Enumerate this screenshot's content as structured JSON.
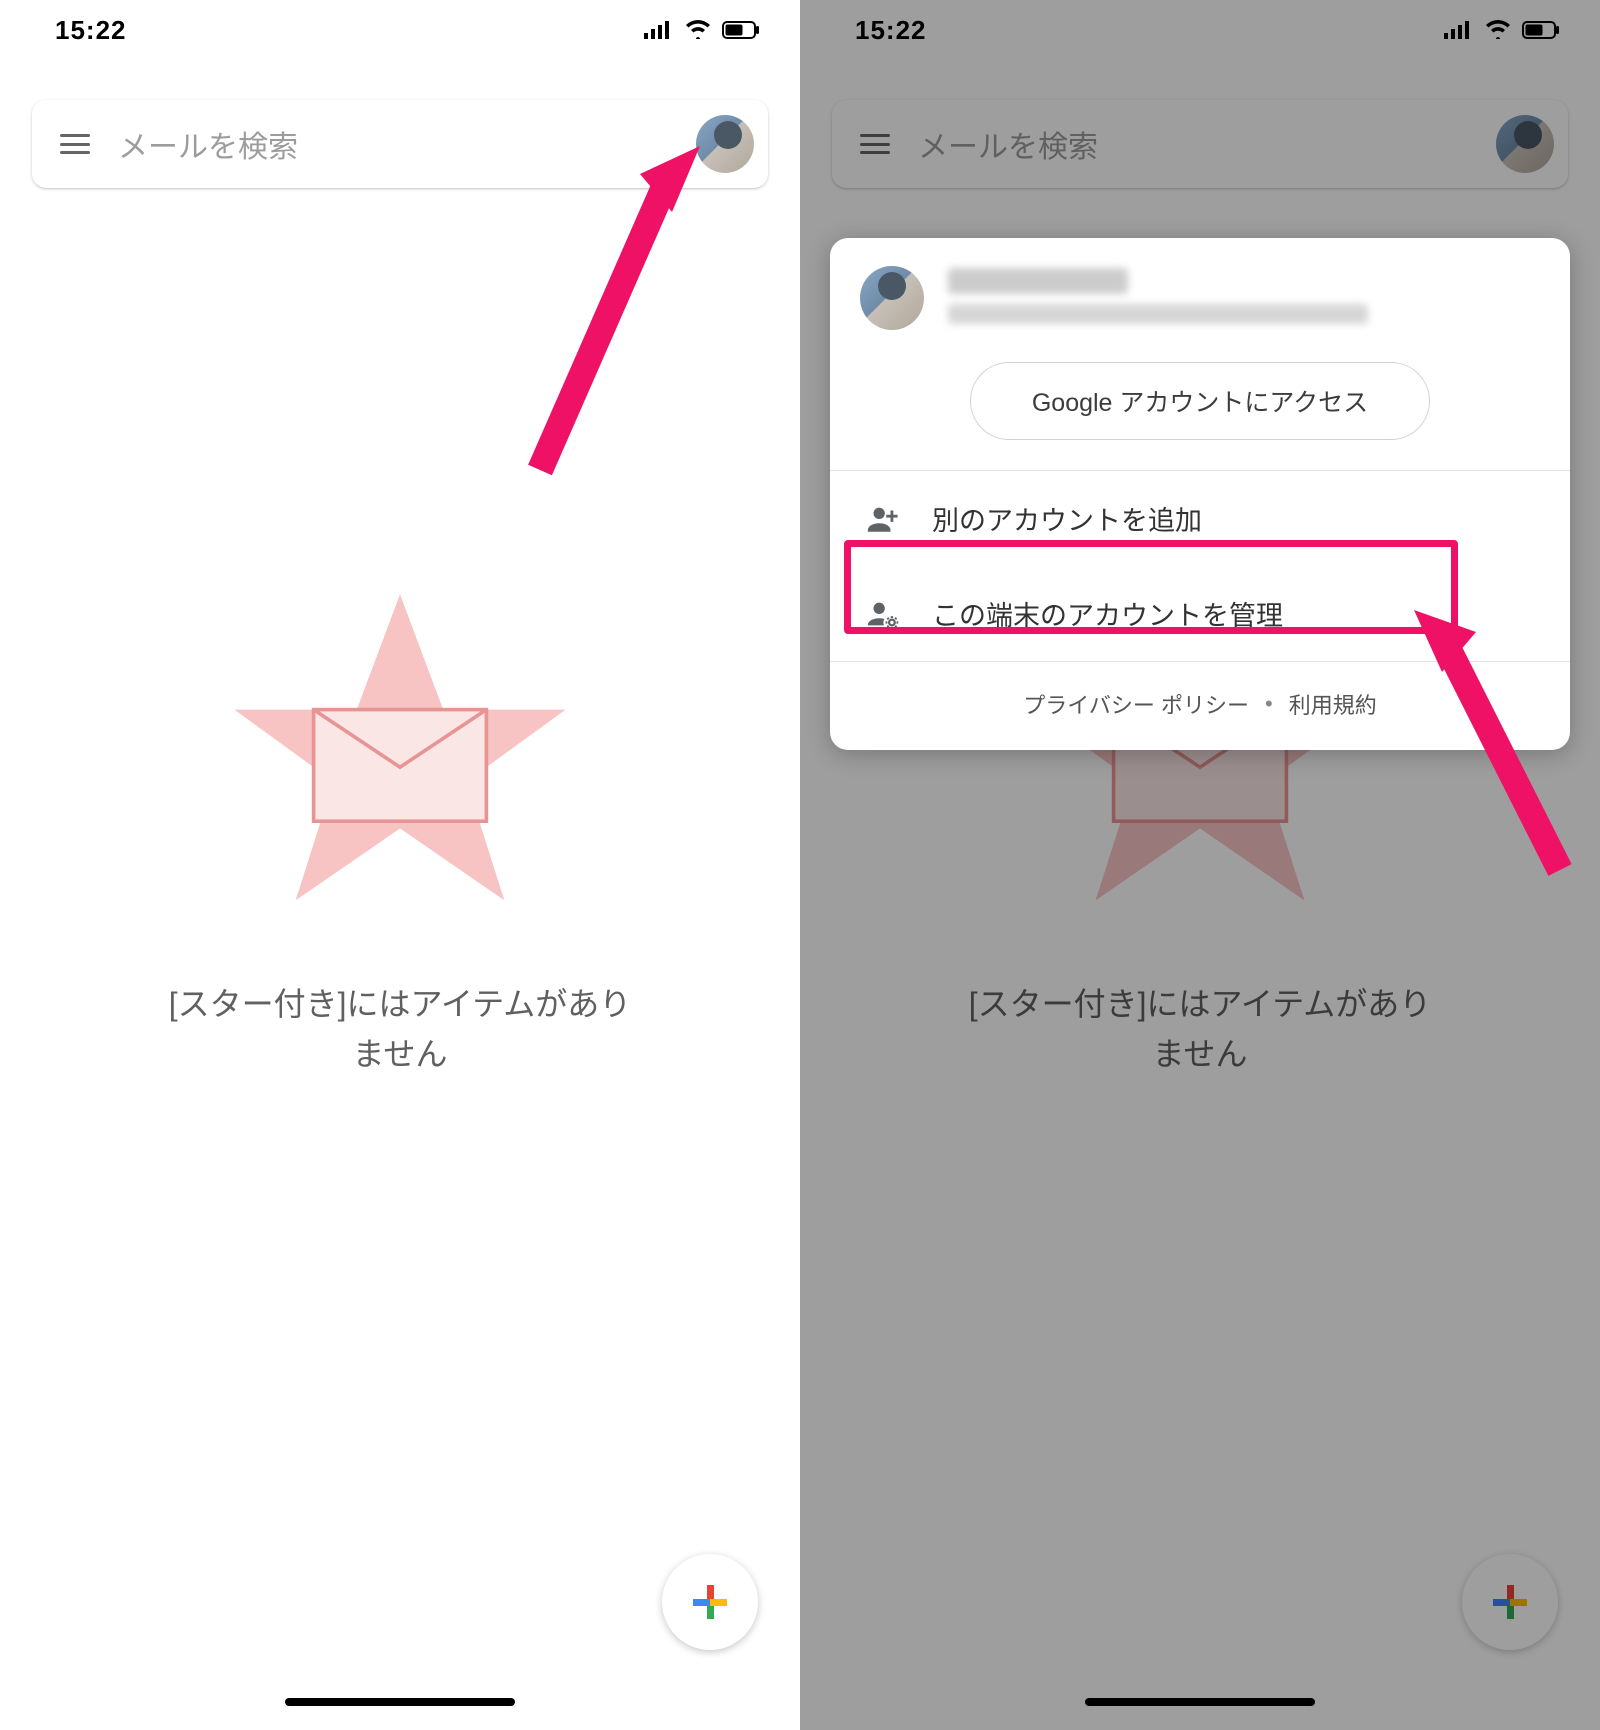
{
  "status": {
    "time": "15:22"
  },
  "search": {
    "placeholder": "メールを検索"
  },
  "empty": {
    "message": "[スター付き]にはアイテムがあり\nません"
  },
  "sheet": {
    "access_button": "Google アカウントにアクセス",
    "add_account": "別のアカウントを追加",
    "manage_accounts": "この端末のアカウントを管理",
    "privacy": "プライバシー ポリシー",
    "terms": "利用規約"
  },
  "annotations": {
    "arrow_color": "#ee1166"
  }
}
